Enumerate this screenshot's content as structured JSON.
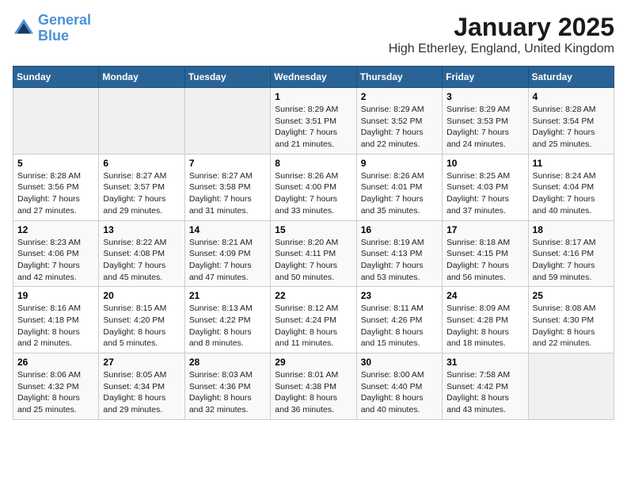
{
  "header": {
    "logo_line1": "General",
    "logo_line2": "Blue",
    "title": "January 2025",
    "subtitle": "High Etherley, England, United Kingdom"
  },
  "calendar": {
    "days_of_week": [
      "Sunday",
      "Monday",
      "Tuesday",
      "Wednesday",
      "Thursday",
      "Friday",
      "Saturday"
    ],
    "weeks": [
      [
        {
          "day": "",
          "sunrise": "",
          "sunset": "",
          "daylight": ""
        },
        {
          "day": "",
          "sunrise": "",
          "sunset": "",
          "daylight": ""
        },
        {
          "day": "",
          "sunrise": "",
          "sunset": "",
          "daylight": ""
        },
        {
          "day": "1",
          "sunrise": "Sunrise: 8:29 AM",
          "sunset": "Sunset: 3:51 PM",
          "daylight": "Daylight: 7 hours and 21 minutes."
        },
        {
          "day": "2",
          "sunrise": "Sunrise: 8:29 AM",
          "sunset": "Sunset: 3:52 PM",
          "daylight": "Daylight: 7 hours and 22 minutes."
        },
        {
          "day": "3",
          "sunrise": "Sunrise: 8:29 AM",
          "sunset": "Sunset: 3:53 PM",
          "daylight": "Daylight: 7 hours and 24 minutes."
        },
        {
          "day": "4",
          "sunrise": "Sunrise: 8:28 AM",
          "sunset": "Sunset: 3:54 PM",
          "daylight": "Daylight: 7 hours and 25 minutes."
        }
      ],
      [
        {
          "day": "5",
          "sunrise": "Sunrise: 8:28 AM",
          "sunset": "Sunset: 3:56 PM",
          "daylight": "Daylight: 7 hours and 27 minutes."
        },
        {
          "day": "6",
          "sunrise": "Sunrise: 8:27 AM",
          "sunset": "Sunset: 3:57 PM",
          "daylight": "Daylight: 7 hours and 29 minutes."
        },
        {
          "day": "7",
          "sunrise": "Sunrise: 8:27 AM",
          "sunset": "Sunset: 3:58 PM",
          "daylight": "Daylight: 7 hours and 31 minutes."
        },
        {
          "day": "8",
          "sunrise": "Sunrise: 8:26 AM",
          "sunset": "Sunset: 4:00 PM",
          "daylight": "Daylight: 7 hours and 33 minutes."
        },
        {
          "day": "9",
          "sunrise": "Sunrise: 8:26 AM",
          "sunset": "Sunset: 4:01 PM",
          "daylight": "Daylight: 7 hours and 35 minutes."
        },
        {
          "day": "10",
          "sunrise": "Sunrise: 8:25 AM",
          "sunset": "Sunset: 4:03 PM",
          "daylight": "Daylight: 7 hours and 37 minutes."
        },
        {
          "day": "11",
          "sunrise": "Sunrise: 8:24 AM",
          "sunset": "Sunset: 4:04 PM",
          "daylight": "Daylight: 7 hours and 40 minutes."
        }
      ],
      [
        {
          "day": "12",
          "sunrise": "Sunrise: 8:23 AM",
          "sunset": "Sunset: 4:06 PM",
          "daylight": "Daylight: 7 hours and 42 minutes."
        },
        {
          "day": "13",
          "sunrise": "Sunrise: 8:22 AM",
          "sunset": "Sunset: 4:08 PM",
          "daylight": "Daylight: 7 hours and 45 minutes."
        },
        {
          "day": "14",
          "sunrise": "Sunrise: 8:21 AM",
          "sunset": "Sunset: 4:09 PM",
          "daylight": "Daylight: 7 hours and 47 minutes."
        },
        {
          "day": "15",
          "sunrise": "Sunrise: 8:20 AM",
          "sunset": "Sunset: 4:11 PM",
          "daylight": "Daylight: 7 hours and 50 minutes."
        },
        {
          "day": "16",
          "sunrise": "Sunrise: 8:19 AM",
          "sunset": "Sunset: 4:13 PM",
          "daylight": "Daylight: 7 hours and 53 minutes."
        },
        {
          "day": "17",
          "sunrise": "Sunrise: 8:18 AM",
          "sunset": "Sunset: 4:15 PM",
          "daylight": "Daylight: 7 hours and 56 minutes."
        },
        {
          "day": "18",
          "sunrise": "Sunrise: 8:17 AM",
          "sunset": "Sunset: 4:16 PM",
          "daylight": "Daylight: 7 hours and 59 minutes."
        }
      ],
      [
        {
          "day": "19",
          "sunrise": "Sunrise: 8:16 AM",
          "sunset": "Sunset: 4:18 PM",
          "daylight": "Daylight: 8 hours and 2 minutes."
        },
        {
          "day": "20",
          "sunrise": "Sunrise: 8:15 AM",
          "sunset": "Sunset: 4:20 PM",
          "daylight": "Daylight: 8 hours and 5 minutes."
        },
        {
          "day": "21",
          "sunrise": "Sunrise: 8:13 AM",
          "sunset": "Sunset: 4:22 PM",
          "daylight": "Daylight: 8 hours and 8 minutes."
        },
        {
          "day": "22",
          "sunrise": "Sunrise: 8:12 AM",
          "sunset": "Sunset: 4:24 PM",
          "daylight": "Daylight: 8 hours and 11 minutes."
        },
        {
          "day": "23",
          "sunrise": "Sunrise: 8:11 AM",
          "sunset": "Sunset: 4:26 PM",
          "daylight": "Daylight: 8 hours and 15 minutes."
        },
        {
          "day": "24",
          "sunrise": "Sunrise: 8:09 AM",
          "sunset": "Sunset: 4:28 PM",
          "daylight": "Daylight: 8 hours and 18 minutes."
        },
        {
          "day": "25",
          "sunrise": "Sunrise: 8:08 AM",
          "sunset": "Sunset: 4:30 PM",
          "daylight": "Daylight: 8 hours and 22 minutes."
        }
      ],
      [
        {
          "day": "26",
          "sunrise": "Sunrise: 8:06 AM",
          "sunset": "Sunset: 4:32 PM",
          "daylight": "Daylight: 8 hours and 25 minutes."
        },
        {
          "day": "27",
          "sunrise": "Sunrise: 8:05 AM",
          "sunset": "Sunset: 4:34 PM",
          "daylight": "Daylight: 8 hours and 29 minutes."
        },
        {
          "day": "28",
          "sunrise": "Sunrise: 8:03 AM",
          "sunset": "Sunset: 4:36 PM",
          "daylight": "Daylight: 8 hours and 32 minutes."
        },
        {
          "day": "29",
          "sunrise": "Sunrise: 8:01 AM",
          "sunset": "Sunset: 4:38 PM",
          "daylight": "Daylight: 8 hours and 36 minutes."
        },
        {
          "day": "30",
          "sunrise": "Sunrise: 8:00 AM",
          "sunset": "Sunset: 4:40 PM",
          "daylight": "Daylight: 8 hours and 40 minutes."
        },
        {
          "day": "31",
          "sunrise": "Sunrise: 7:58 AM",
          "sunset": "Sunset: 4:42 PM",
          "daylight": "Daylight: 8 hours and 43 minutes."
        },
        {
          "day": "",
          "sunrise": "",
          "sunset": "",
          "daylight": ""
        }
      ]
    ]
  }
}
